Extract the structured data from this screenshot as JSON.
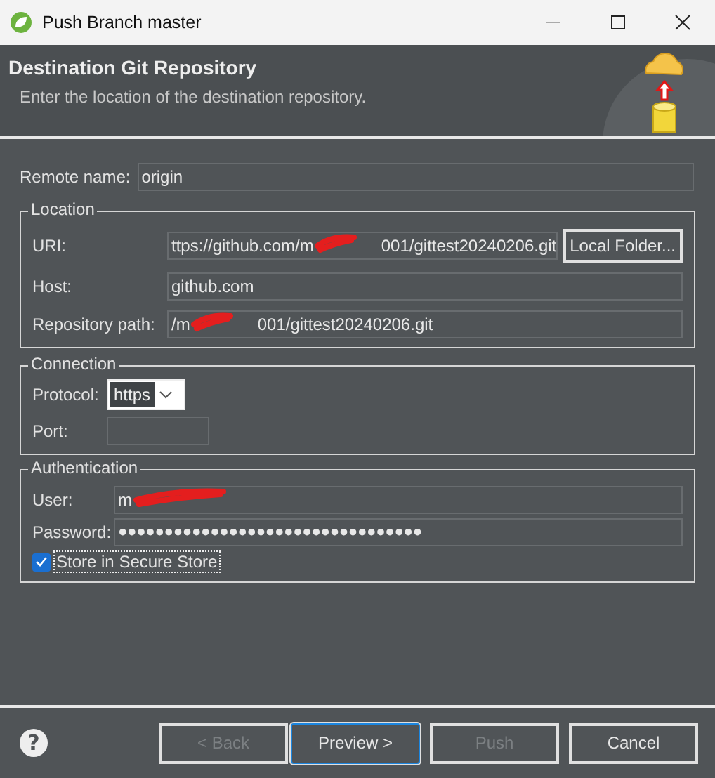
{
  "window": {
    "title": "Push Branch master"
  },
  "header": {
    "title": "Destination Git Repository",
    "description": "Enter the location of the destination repository."
  },
  "remote_name": {
    "label": "Remote name:",
    "value": "origin"
  },
  "location": {
    "title": "Location",
    "fields": [
      {
        "label": "URI:",
        "value": "ttps://github.com/m",
        "value_after": "001/gittest20240206.git",
        "redacted": true
      },
      {
        "label": "Host:",
        "value": "github.com",
        "redacted": false
      },
      {
        "label": "Repository path:",
        "value": "/m",
        "value_after": "001/gittest20240206.git",
        "redacted": true
      }
    ],
    "local_folder_button": "Local Folder..."
  },
  "connection": {
    "title": "Connection",
    "protocol": {
      "label": "Protocol:",
      "value": "https"
    },
    "port": {
      "label": "Port:"
    }
  },
  "authentication": {
    "title": "Authentication",
    "user": {
      "label": "User:",
      "value": "m",
      "redacted": true
    },
    "password": {
      "label": "Password:",
      "value": "●●●●●●●●●●●●●●●●●●●●●●●●●●●●●●●●●"
    },
    "store": {
      "label": "Store in Secure Store",
      "checked": true
    }
  },
  "help": "?",
  "buttons": [
    {
      "label": "< Back",
      "disabled": true,
      "default": false
    },
    {
      "label": "Preview >",
      "disabled": false,
      "default": true
    },
    {
      "label": "Push",
      "disabled": true,
      "default": false
    },
    {
      "label": "Cancel",
      "disabled": false,
      "default": false
    }
  ]
}
